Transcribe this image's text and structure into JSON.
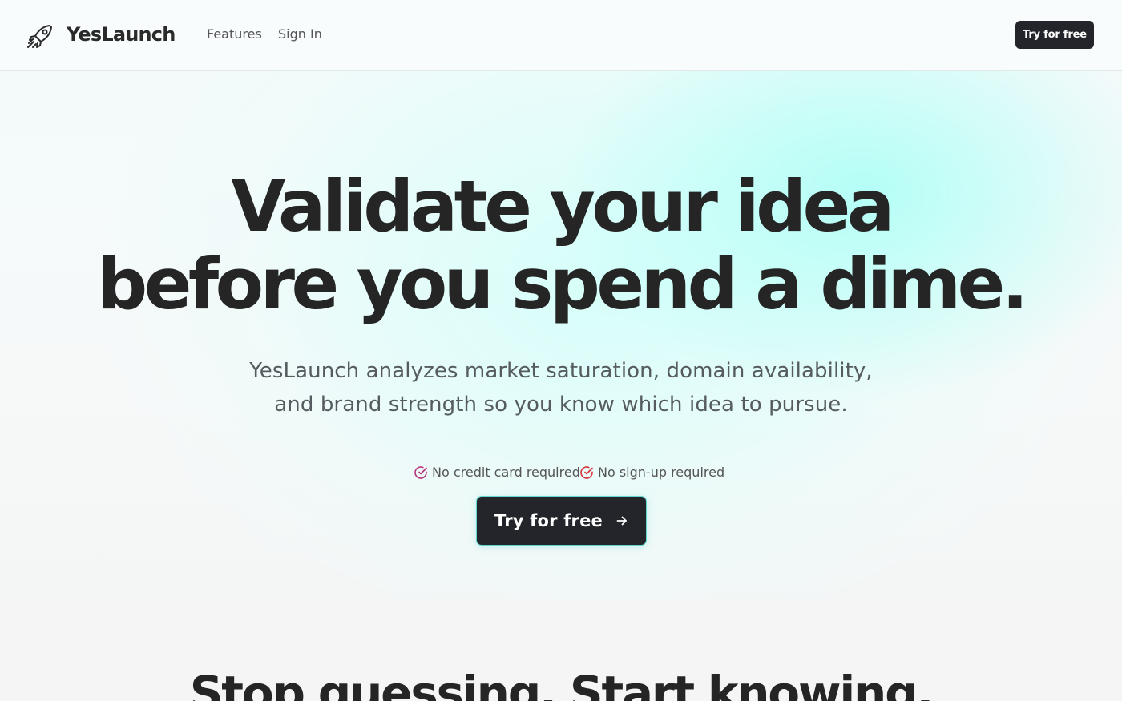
{
  "brand": {
    "name": "YesLaunch",
    "logo_icon": "rocket-icon"
  },
  "nav": {
    "items": [
      {
        "label": "Features"
      },
      {
        "label": "Sign In"
      }
    ]
  },
  "header": {
    "cta_label": "Try for free"
  },
  "hero": {
    "headline_line1": "Validate your idea",
    "headline_line2": "before you spend a dime.",
    "subtitle_line1": "YesLaunch analyzes market saturation, domain availability,",
    "subtitle_line2": "and brand strength so you know which idea to pursue.",
    "perks": [
      {
        "icon": "check-circle-icon",
        "label": "No credit card required",
        "color": "#b8337a"
      },
      {
        "icon": "check-circle-icon",
        "label": "No sign-up required",
        "color": "#d8343f"
      }
    ],
    "cta_label": "Try for free",
    "cta_icon": "arrow-right-icon"
  },
  "section2": {
    "heading": "Stop guessing. Start knowing."
  },
  "colors": {
    "dark": "#24252a",
    "accent_glow": "#aafff6",
    "text_muted": "#555b5f"
  }
}
